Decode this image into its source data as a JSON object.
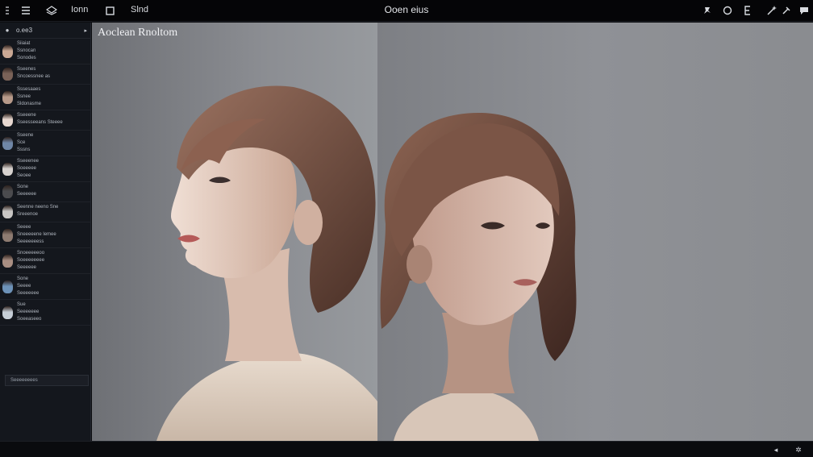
{
  "topbar": {
    "menu_label": "Ionn",
    "file_label": "Slnd",
    "title": "Ooen eius"
  },
  "sidebar": {
    "header_label": "o.ee3",
    "groups": [
      {
        "skin": "#caa894",
        "lines": [
          "Siiaiat",
          "Ssnocan",
          "Sonodes"
        ]
      },
      {
        "skin": "#7a6258",
        "lines": [
          "Sseenes",
          "Sncoessnee as",
          ""
        ]
      },
      {
        "skin": "#b79a8a",
        "lines": [
          "Sssesaaes",
          "Ssnee",
          "Sldonasme"
        ]
      },
      {
        "skin": "#e7d8d0",
        "lines": [
          "Sseeene",
          "Sseesseeans Steeee",
          ""
        ]
      },
      {
        "skin": "#6f86a6",
        "lines": [
          "Sseene",
          "Sce",
          "Sssns"
        ]
      },
      {
        "skin": "#d7d2cf",
        "lines": [
          "Sseeenee",
          "Soeeeee",
          "Seoee"
        ]
      },
      {
        "skin": "#4b4b4e",
        "lines": [
          "Sone",
          "Seeeeee",
          ""
        ]
      },
      {
        "skin": "#c8c6c4",
        "lines": [
          "Seenne neeno Sne",
          "Sreeenoe",
          ""
        ]
      },
      {
        "skin": "#8e7b71",
        "lines": [
          "Seeee",
          "Sneeeeene lemee",
          "Seeeeeeess"
        ]
      },
      {
        "skin": "#a98f83",
        "lines": [
          "Snoeeeeeoo",
          "Soeeeeeeee",
          "Seeeeee"
        ]
      },
      {
        "skin": "#6d92b8",
        "lines": [
          "Sone",
          "Seeee",
          "Seeeeeee"
        ]
      },
      {
        "skin": "#c6ced7",
        "lines": [
          "Sue",
          "Seeeeeee",
          "Soeeaseeo"
        ]
      }
    ],
    "footer": "Seeeeeeees"
  },
  "canvas": {
    "label": "Aoclean Rnoltom"
  }
}
